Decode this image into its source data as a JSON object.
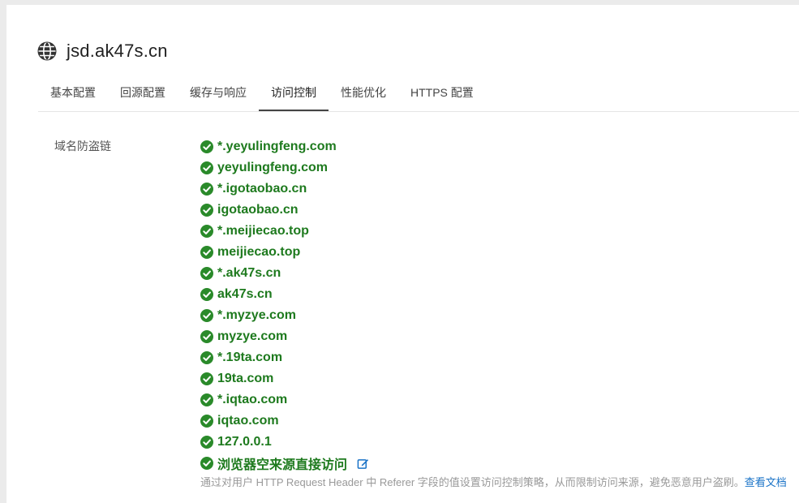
{
  "domain": {
    "title": "jsd.ak47s.cn",
    "icon": "globe-icon"
  },
  "tabs": [
    {
      "label": "基本配置",
      "active": false
    },
    {
      "label": "回源配置",
      "active": false
    },
    {
      "label": "缓存与响应",
      "active": false
    },
    {
      "label": "访问控制",
      "active": true
    },
    {
      "label": "性能优化",
      "active": false
    },
    {
      "label": "HTTPS 配置",
      "active": false
    }
  ],
  "referer": {
    "label": "域名防盗链",
    "whitelist": [
      "*.yeyulingfeng.com",
      "yeyulingfeng.com",
      "*.igotaobao.cn",
      "igotaobao.cn",
      "*.meijiecao.top",
      "meijiecao.top",
      "*.ak47s.cn",
      "ak47s.cn",
      "*.myzye.com",
      "myzye.com",
      "*.19ta.com",
      "19ta.com",
      "*.iqtao.com",
      "iqtao.com",
      "127.0.0.1",
      "浏览器空来源直接访问"
    ],
    "check_icon": "check-circle-icon",
    "edit_icon": "edit-icon",
    "description": "通过对用户 HTTP Request Header 中 Referer 字段的值设置访问控制策略，从而限制访问来源，避免恶意用户盗刷。",
    "doc_link": "查看文档"
  },
  "colors": {
    "success_green": "#1e7a1e",
    "check_green": "#2a8a2a",
    "link_blue": "#1a73c7"
  }
}
